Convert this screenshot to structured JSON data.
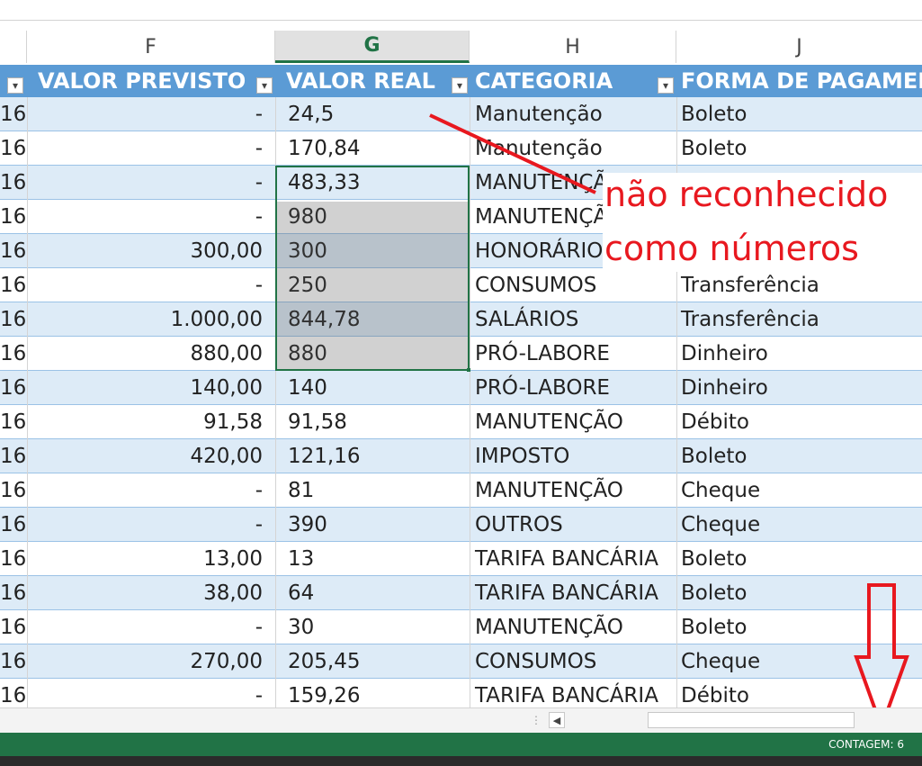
{
  "column_letters": [
    "F",
    "G",
    "H",
    "J"
  ],
  "selected_column": "G",
  "table_headers": {
    "valor_previsto": "VALOR PREVISTO",
    "valor_real": "VALOR REAL",
    "categoria": "CATEGORIA",
    "forma_pagamento": "FORMA DE PAGAMENTO"
  },
  "rows": [
    {
      "e": "16",
      "f": "-",
      "g": "24,5",
      "h": "Manutenção",
      "j": "Boleto"
    },
    {
      "e": "16",
      "f": "-",
      "g": "170,84",
      "h": "Manutenção",
      "j": "Boleto"
    },
    {
      "e": "16",
      "f": "-",
      "g": "483,33",
      "h": "MANUTENÇÃO",
      "j": ""
    },
    {
      "e": "16",
      "f": "-",
      "g": "980",
      "h": "MANUTENÇÃO",
      "j": ""
    },
    {
      "e": "16",
      "f": "300,00",
      "g": "300",
      "h": "HONORÁRIOS",
      "j": ""
    },
    {
      "e": "16",
      "f": "-",
      "g": "250",
      "h": "CONSUMOS",
      "j": "Transferência"
    },
    {
      "e": "16",
      "f": "1.000,00",
      "g": "844,78",
      "h": "SALÁRIOS",
      "j": "Transferência"
    },
    {
      "e": "16",
      "f": "880,00",
      "g": "880",
      "h": "PRÓ-LABORE",
      "j": "Dinheiro"
    },
    {
      "e": "16",
      "f": "140,00",
      "g": "140",
      "h": "PRÓ-LABORE",
      "j": "Dinheiro"
    },
    {
      "e": "16",
      "f": "91,58",
      "g": "91,58",
      "h": "MANUTENÇÃO",
      "j": "Débito"
    },
    {
      "e": "16",
      "f": "420,00",
      "g": "121,16",
      "h": "IMPOSTO",
      "j": "Boleto"
    },
    {
      "e": "16",
      "f": "-",
      "g": "81",
      "h": "MANUTENÇÃO",
      "j": "Cheque"
    },
    {
      "e": "16",
      "f": "-",
      "g": "390",
      "h": "OUTROS",
      "j": "Cheque"
    },
    {
      "e": "16",
      "f": "13,00",
      "g": "13",
      "h": "TARIFA BANCÁRIA",
      "j": "Boleto"
    },
    {
      "e": "16",
      "f": "38,00",
      "g": "64",
      "h": "TARIFA BANCÁRIA",
      "j": "Boleto"
    },
    {
      "e": "16",
      "f": "-",
      "g": "30",
      "h": "MANUTENÇÃO",
      "j": "Boleto"
    },
    {
      "e": "16",
      "f": "270,00",
      "g": "205,45",
      "h": "CONSUMOS",
      "j": "Cheque"
    },
    {
      "e": "16",
      "f": "-",
      "g": "159,26",
      "h": "TARIFA BANCÁRIA",
      "j": "Débito"
    }
  ],
  "annotation": {
    "line1": "não reconhecido",
    "line2": "como números"
  },
  "status_bar": {
    "count_text": "CONTAGEM: 6"
  },
  "colors": {
    "header_blue": "#5b9bd5",
    "band_blue": "#ddebf7",
    "excel_green": "#217346",
    "annotation_red": "#e8181f"
  }
}
